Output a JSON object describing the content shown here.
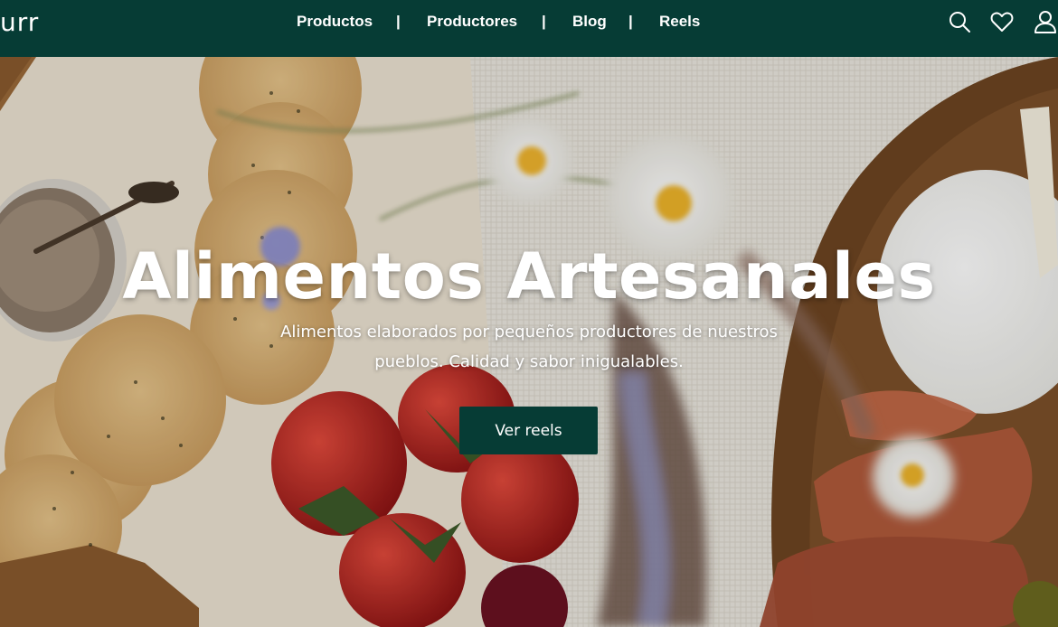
{
  "header": {
    "logo_text": "urr",
    "nav": [
      {
        "label": "Productos"
      },
      {
        "label": "Productores"
      },
      {
        "label": "Blog"
      },
      {
        "label": "Reels"
      }
    ],
    "separator": "|",
    "icons": [
      "search-icon",
      "heart-icon",
      "user-icon"
    ]
  },
  "hero": {
    "title": "Alimentos Artesanales",
    "subtitle": "Alimentos elaborados por pequeños productores de nuestros pueblos. Calidad y sabor inigualables.",
    "cta_label": "Ver reels",
    "image_alt": "food-platter-photo"
  },
  "colors": {
    "brand_dark_green": "#063c35",
    "text_white": "#ffffff"
  }
}
